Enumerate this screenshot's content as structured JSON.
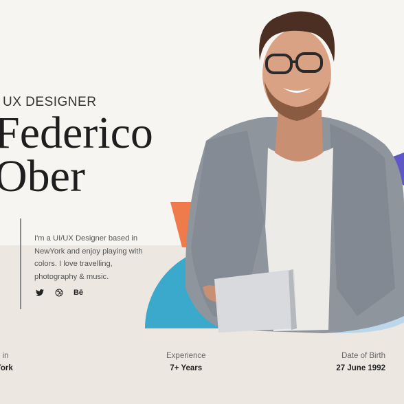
{
  "hero": {
    "role": "UX DESIGNER",
    "name_line1": "Federico",
    "name_line2": "Ober",
    "bio": "I'm a UI/UX Designer based in NewYork and enjoy playing with colors. I love travelling, photography & music."
  },
  "social": {
    "twitter": "twitter-icon",
    "dribbble": "dribbble-icon",
    "behance_label": "Bē"
  },
  "stats": [
    {
      "label": "n in",
      "value": "York"
    },
    {
      "label": "Experience",
      "value": "7+ Years"
    },
    {
      "label": "Date of Birth",
      "value": "27 June 1992"
    }
  ],
  "colors": {
    "background": "#f7f5f1",
    "band": "#ece7e1",
    "teal": "#3aa9cc",
    "orange": "#ef7a4b",
    "purple": "#5d57c8",
    "yellow": "#f2c23c"
  }
}
